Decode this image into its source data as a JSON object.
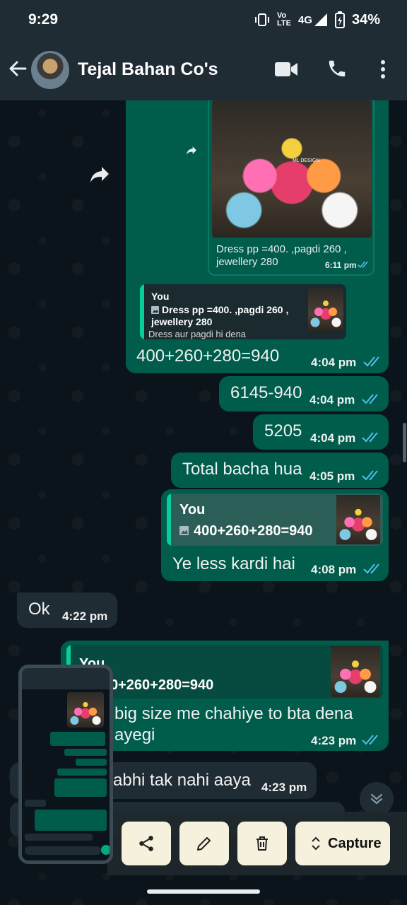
{
  "status": {
    "time": "9:29",
    "network": "4G",
    "volte_top": "Vo",
    "volte_bottom": "LTE",
    "battery": "34%"
  },
  "header": {
    "contact_name": "Tejal Bahan Co's"
  },
  "messages": {
    "image_msg": {
      "caption_line1": "Dress pp =400.  ,pagdi 260 ,",
      "caption_line2": "jewellery 280",
      "time": "6:11 pm",
      "watermark": "ML DESIGN"
    },
    "reply1": {
      "quote_author": "You",
      "quote_line1": "Dress pp =400.  ,pagdi 260 ,",
      "quote_line2": "jewellery 280",
      "quote_line3": "Dress aur pagdi hi dena",
      "text": "400+260+280=940",
      "time": "4:04 pm"
    },
    "m2": {
      "text": "6145-940",
      "time": "4:04 pm"
    },
    "m3": {
      "text": "5205",
      "time": "4:04 pm"
    },
    "m4": {
      "text": "Total bacha hua",
      "time": "4:05 pm"
    },
    "reply2": {
      "quote_author": "You",
      "quote_line": "400+260+280=940",
      "text": "Ye less kardi hai",
      "time": "4:08 pm"
    },
    "in1": {
      "text": "Ok",
      "time": "4:22 pm"
    },
    "reply3": {
      "quote_author": "You",
      "quote_line": "0+260+280=940",
      "text_line1": "big size me chahiye to bta dena",
      "text_line2": "ayegi",
      "time": "4:23 pm"
    },
    "in2": {
      "text": "abhi tak nahi aaya",
      "time": "4:23 pm"
    }
  },
  "actions": {
    "capture_label": "Capture"
  },
  "icons": {
    "back": "arrow-left-icon",
    "video": "video-call-icon",
    "call": "phone-icon",
    "more": "more-vertical-icon",
    "share": "share-icon",
    "edit": "pencil-icon",
    "delete": "trash-icon",
    "expand": "chevron-up-down-icon",
    "scroll": "chevrons-down-icon",
    "forward": "forward-arrow-icon"
  },
  "colors": {
    "outgoing": "#005c4b",
    "incoming": "#1f2c33",
    "header": "#1f2c33",
    "tick_read": "#53bdeb"
  }
}
